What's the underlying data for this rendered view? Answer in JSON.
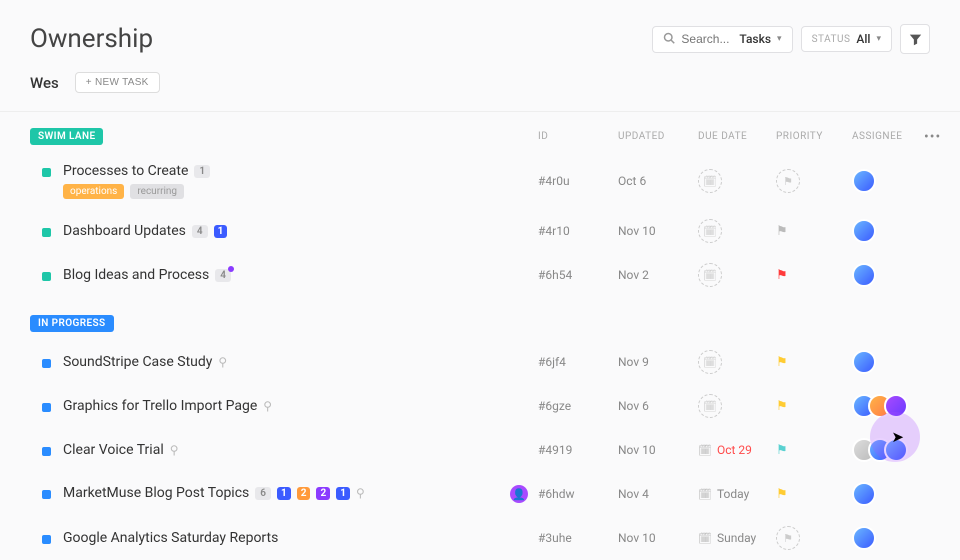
{
  "header": {
    "title": "Ownership",
    "search_placeholder": "Search...",
    "search_scope": "Tasks",
    "status_label": "STATUS",
    "status_value": "All"
  },
  "subheader": {
    "assignee": "Wes",
    "new_task": "+ NEW TASK"
  },
  "columns": {
    "group": "SWIM LANE",
    "id": "ID",
    "updated": "UPDATED",
    "due": "DUE DATE",
    "priority": "PRIORITY",
    "assignee": "ASSIGNEE"
  },
  "groups": [
    {
      "label": "SWIM LANE",
      "pill_class": "pill-swimlane",
      "dot_class": "dot-teal",
      "tasks": [
        {
          "title": "Processes to Create",
          "count": "1",
          "tags": [
            {
              "text": "operations",
              "class": "tag-ops"
            },
            {
              "text": "recurring",
              "class": "tag-rec"
            }
          ],
          "id": "#4r0u",
          "updated": "Oct 6",
          "due": null,
          "priority": null,
          "avatars": [
            "avatar"
          ]
        },
        {
          "title": "Dashboard Updates",
          "count": "4",
          "badges": [
            {
              "text": "1",
              "class": "mb-blue"
            }
          ],
          "id": "#4r10",
          "updated": "Nov 10",
          "due": null,
          "priority": "gray",
          "avatars": [
            "avatar"
          ]
        },
        {
          "title": "Blog Ideas and Process",
          "count": "4",
          "count_notif": true,
          "id": "#6h54",
          "updated": "Nov 2",
          "due": null,
          "priority": "red",
          "avatars": [
            "avatar"
          ]
        }
      ]
    },
    {
      "label": "IN PROGRESS",
      "pill_class": "pill-inprogress",
      "dot_class": "dot-blue",
      "tasks": [
        {
          "title": "SoundStripe Case Study",
          "clip": true,
          "id": "#6jf4",
          "updated": "Nov 9",
          "due": null,
          "priority": "yellow",
          "avatars": [
            "avatar"
          ]
        },
        {
          "title": "Graphics for Trello Import Page",
          "clip": true,
          "id": "#6gze",
          "updated": "Nov 6",
          "due": null,
          "priority": "yellow",
          "avatars": [
            "avatar",
            "avatar alt1",
            "avatar alt2"
          ]
        },
        {
          "title": "Clear Voice Trial",
          "clip": true,
          "id": "#4919",
          "updated": "Nov 10",
          "due": "Oct 29",
          "due_class": "due-red",
          "priority": "teal",
          "avatars": [
            "avatar alt3",
            "avatar",
            "avatar"
          ]
        },
        {
          "title": "MarketMuse Blog Post Topics",
          "count": "6",
          "badges": [
            {
              "text": "1",
              "class": "mb-blue"
            },
            {
              "text": "2",
              "class": "mb-orange"
            },
            {
              "text": "2",
              "class": "mb-purple"
            },
            {
              "text": "1",
              "class": "mb-blue"
            }
          ],
          "clip": true,
          "inline_icon": true,
          "id": "#6hdw",
          "updated": "Nov 4",
          "due": "Today",
          "due_class": "due-gray",
          "priority": "yellow",
          "avatars": [
            "avatar"
          ]
        },
        {
          "title": "Google Analytics Saturday Reports",
          "id": "#3uhe",
          "updated": "Nov 10",
          "due": "Sunday",
          "due_class": "due-gray",
          "priority": null,
          "avatars": [
            "avatar"
          ]
        }
      ]
    }
  ]
}
